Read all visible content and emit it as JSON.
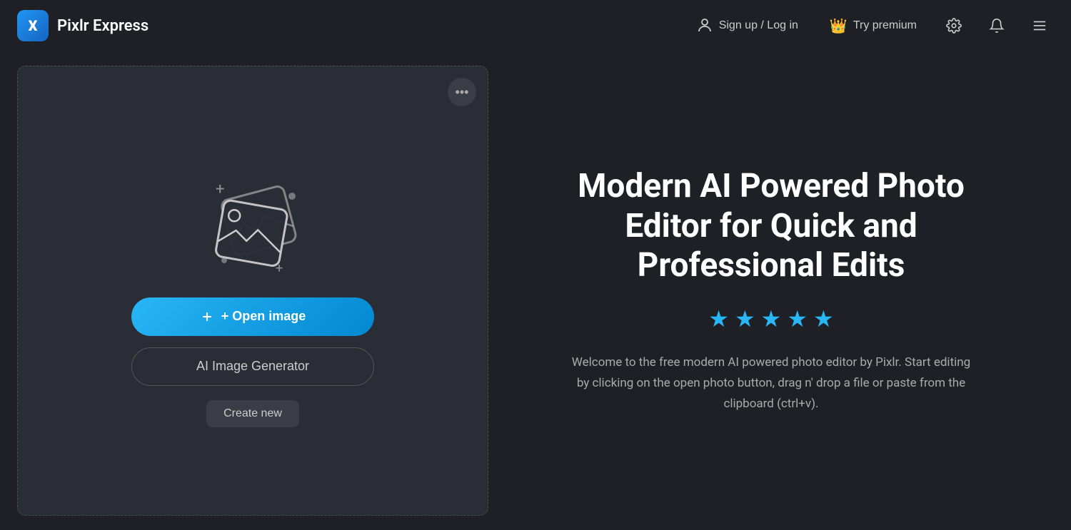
{
  "header": {
    "logo_text": "X",
    "app_title": "Pixlr Express",
    "sign_up_label": "Sign up / Log in",
    "try_premium_label": "Try premium",
    "settings_icon": "⚙",
    "notification_icon": "🔔",
    "menu_icon": "☰"
  },
  "left_panel": {
    "more_options_icon": "•••",
    "open_image_label": "+ Open image",
    "ai_generator_label": "AI Image Generator",
    "create_new_label": "Create new"
  },
  "right_panel": {
    "hero_title": "Modern AI Powered Photo Editor for Quick and Professional Edits",
    "stars": [
      "★",
      "★",
      "★",
      "★",
      "★"
    ],
    "description": "Welcome to the free modern AI powered photo editor by Pixlr. Start editing by clicking on the open photo button, drag n' drop a file or paste from the clipboard (ctrl+v)."
  }
}
